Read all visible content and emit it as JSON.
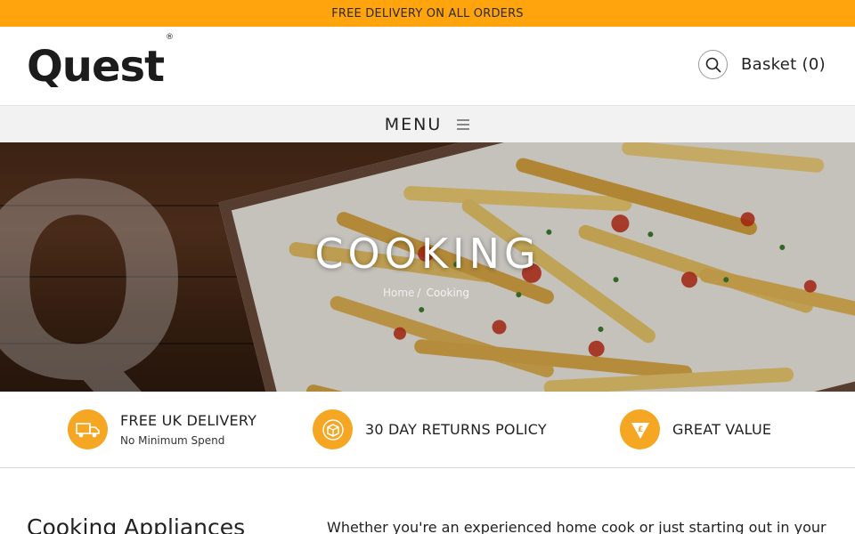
{
  "topbar": {
    "text": "FREE DELIVERY ON ALL ORDERS"
  },
  "header": {
    "logo": "Quest",
    "logo_mark": "®",
    "search_icon": "search-icon",
    "basket_label": "Basket (0)"
  },
  "nav": {
    "menu_label": "MENU",
    "menu_icon": "hamburger-icon"
  },
  "hero": {
    "title": "COOKING",
    "breadcrumb": {
      "home": "Home",
      "separator": "/",
      "current": "Cooking"
    }
  },
  "usps": [
    {
      "icon": "delivery-truck-icon",
      "title": "FREE UK DELIVERY",
      "subtitle": "No Minimum Spend"
    },
    {
      "icon": "returns-box-icon",
      "title": "30 DAY RETURNS POLICY"
    },
    {
      "icon": "pound-value-icon",
      "title": "GREAT VALUE"
    }
  ],
  "content": {
    "heading": "Cooking Appliances",
    "intro": "Whether you're an experienced home cook or just starting out in your"
  },
  "colors": {
    "accent": "#ffa40c",
    "icon_bg": "#f5a623",
    "menu_bg": "#f2f2f2"
  }
}
